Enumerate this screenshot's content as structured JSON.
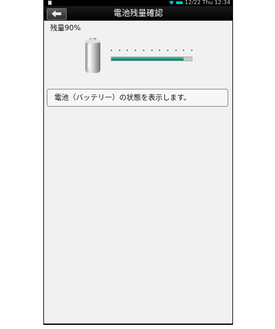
{
  "status_bar": {
    "left_icon": "notification-icon",
    "wifi_icon": "wifi-icon",
    "battery_icon": "battery-status-icon",
    "battery_color": "#00c8c8",
    "datetime": "12/22 Thu  12:34"
  },
  "header": {
    "back_icon": "back-arrow-icon",
    "title": "電池残量確認"
  },
  "battery": {
    "label": "残量90%",
    "level_fraction": 0.9,
    "bar_color": "#129679"
  },
  "message": {
    "text": "電池（バッテリー）の状態を表示します。"
  }
}
